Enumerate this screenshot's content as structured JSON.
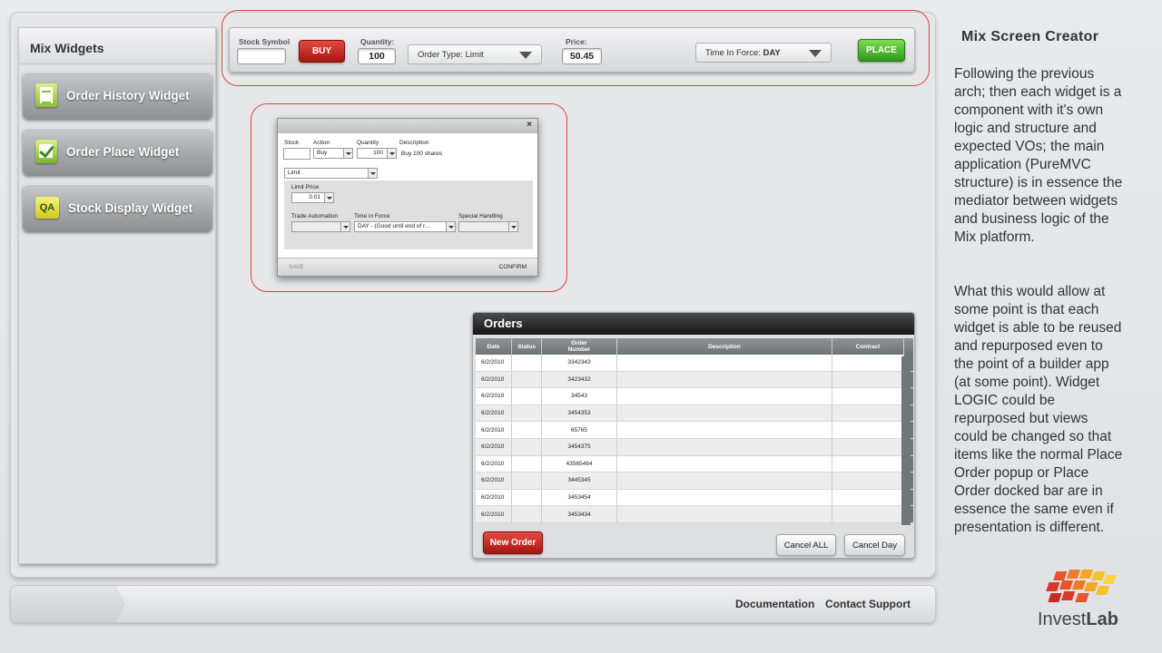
{
  "sidebar": {
    "title": "Mix Widgets",
    "items": [
      {
        "label": "Order History Widget",
        "icon": "document-icon"
      },
      {
        "label": "Order Place Widget",
        "icon": "checkbox-icon"
      },
      {
        "label": "Stock Display Widget",
        "icon": "qa-icon",
        "icon_text": "QA"
      }
    ]
  },
  "order_bar": {
    "stock_symbol_label": "Stock Symbol",
    "stock_symbol_value": "",
    "buy_label": "BUY",
    "quantity_label": "Quantity:",
    "quantity_value": "100",
    "order_type_prefix": "Order Type:",
    "order_type_value": "Limit",
    "price_label": "Price:",
    "price_value": "50.45",
    "tif_prefix": "Time In Force:",
    "tif_value": "DAY",
    "place_label": "PLACE"
  },
  "popup": {
    "close": "×",
    "stock_label": "Stock",
    "action_label": "Action",
    "action_value": "Buy",
    "quantity_label": "Quantity",
    "quantity_value": "100",
    "description_label": "Description",
    "description_value": "Buy 100 shares",
    "order_type_value": "Limit",
    "limit_price_label": "Limit Price",
    "limit_price_value": "0.01",
    "trade_automation_label": "Trade Automation",
    "tif_label": "Time in Force",
    "tif_value": "DAY - (Good until end of r...",
    "special_handling_label": "Special Handling",
    "save_label": "SAVE",
    "confirm_label": "CONFIRM"
  },
  "orders": {
    "title": "Orders",
    "columns": [
      "Date",
      "Status",
      "Order Number",
      "Description",
      "Contract"
    ],
    "rows": [
      {
        "date": "6/2/2010",
        "status": "",
        "order_number": "3342343",
        "description": "",
        "contract": ""
      },
      {
        "date": "6/2/2010",
        "status": "",
        "order_number": "3423432",
        "description": "",
        "contract": ""
      },
      {
        "date": "6/2/2010",
        "status": "",
        "order_number": "34543",
        "description": "",
        "contract": ""
      },
      {
        "date": "6/2/2010",
        "status": "",
        "order_number": "3454353",
        "description": "",
        "contract": ""
      },
      {
        "date": "6/2/2010",
        "status": "",
        "order_number": "65765",
        "description": "",
        "contract": ""
      },
      {
        "date": "6/2/2010",
        "status": "",
        "order_number": "3454375",
        "description": "",
        "contract": ""
      },
      {
        "date": "6/2/2010",
        "status": "",
        "order_number": "43565464",
        "description": "",
        "contract": ""
      },
      {
        "date": "6/2/2010",
        "status": "",
        "order_number": "3445345",
        "description": "",
        "contract": ""
      },
      {
        "date": "6/2/2010",
        "status": "",
        "order_number": "3453454",
        "description": "",
        "contract": ""
      },
      {
        "date": "6/2/2010",
        "status": "",
        "order_number": "3453434",
        "description": "",
        "contract": ""
      }
    ],
    "new_order_label": "New Order",
    "cancel_all_label": "Cancel ALL",
    "cancel_day_label": "Cancel Day"
  },
  "footer": {
    "documentation": "Documentation",
    "contact_support": "Contact Support"
  },
  "side_panel": {
    "title": "Mix Screen Creator",
    "para1_lines": [
      "Following the previous",
      "arch; then each widget is a",
      "component with it's own",
      "logic and structure and",
      "expected VOs; the main",
      "application (PureMVC",
      "structure) is in essence the",
      "mediator between widgets",
      "and business logic of the",
      "Mix platform."
    ],
    "para2_lines": [
      "What this would allow at",
      "some point is that each",
      "widget is able to be reused",
      "and repurposed even to",
      "the point of a builder app",
      "(at some point).  Widget",
      "LOGIC could be",
      "repurposed but views",
      "could be changed so that",
      "items like the normal Place",
      "Order popup or Place",
      "Order docked bar are in",
      "essence the same even if",
      "presentation is different."
    ]
  },
  "logo": {
    "text_a": "Invest",
    "text_b": "Lab"
  },
  "colors": {
    "accent_red": "#c0211a",
    "accent_green": "#3fae22",
    "outline_red": "#d8463a",
    "header_dark": "#1c1c1c"
  }
}
